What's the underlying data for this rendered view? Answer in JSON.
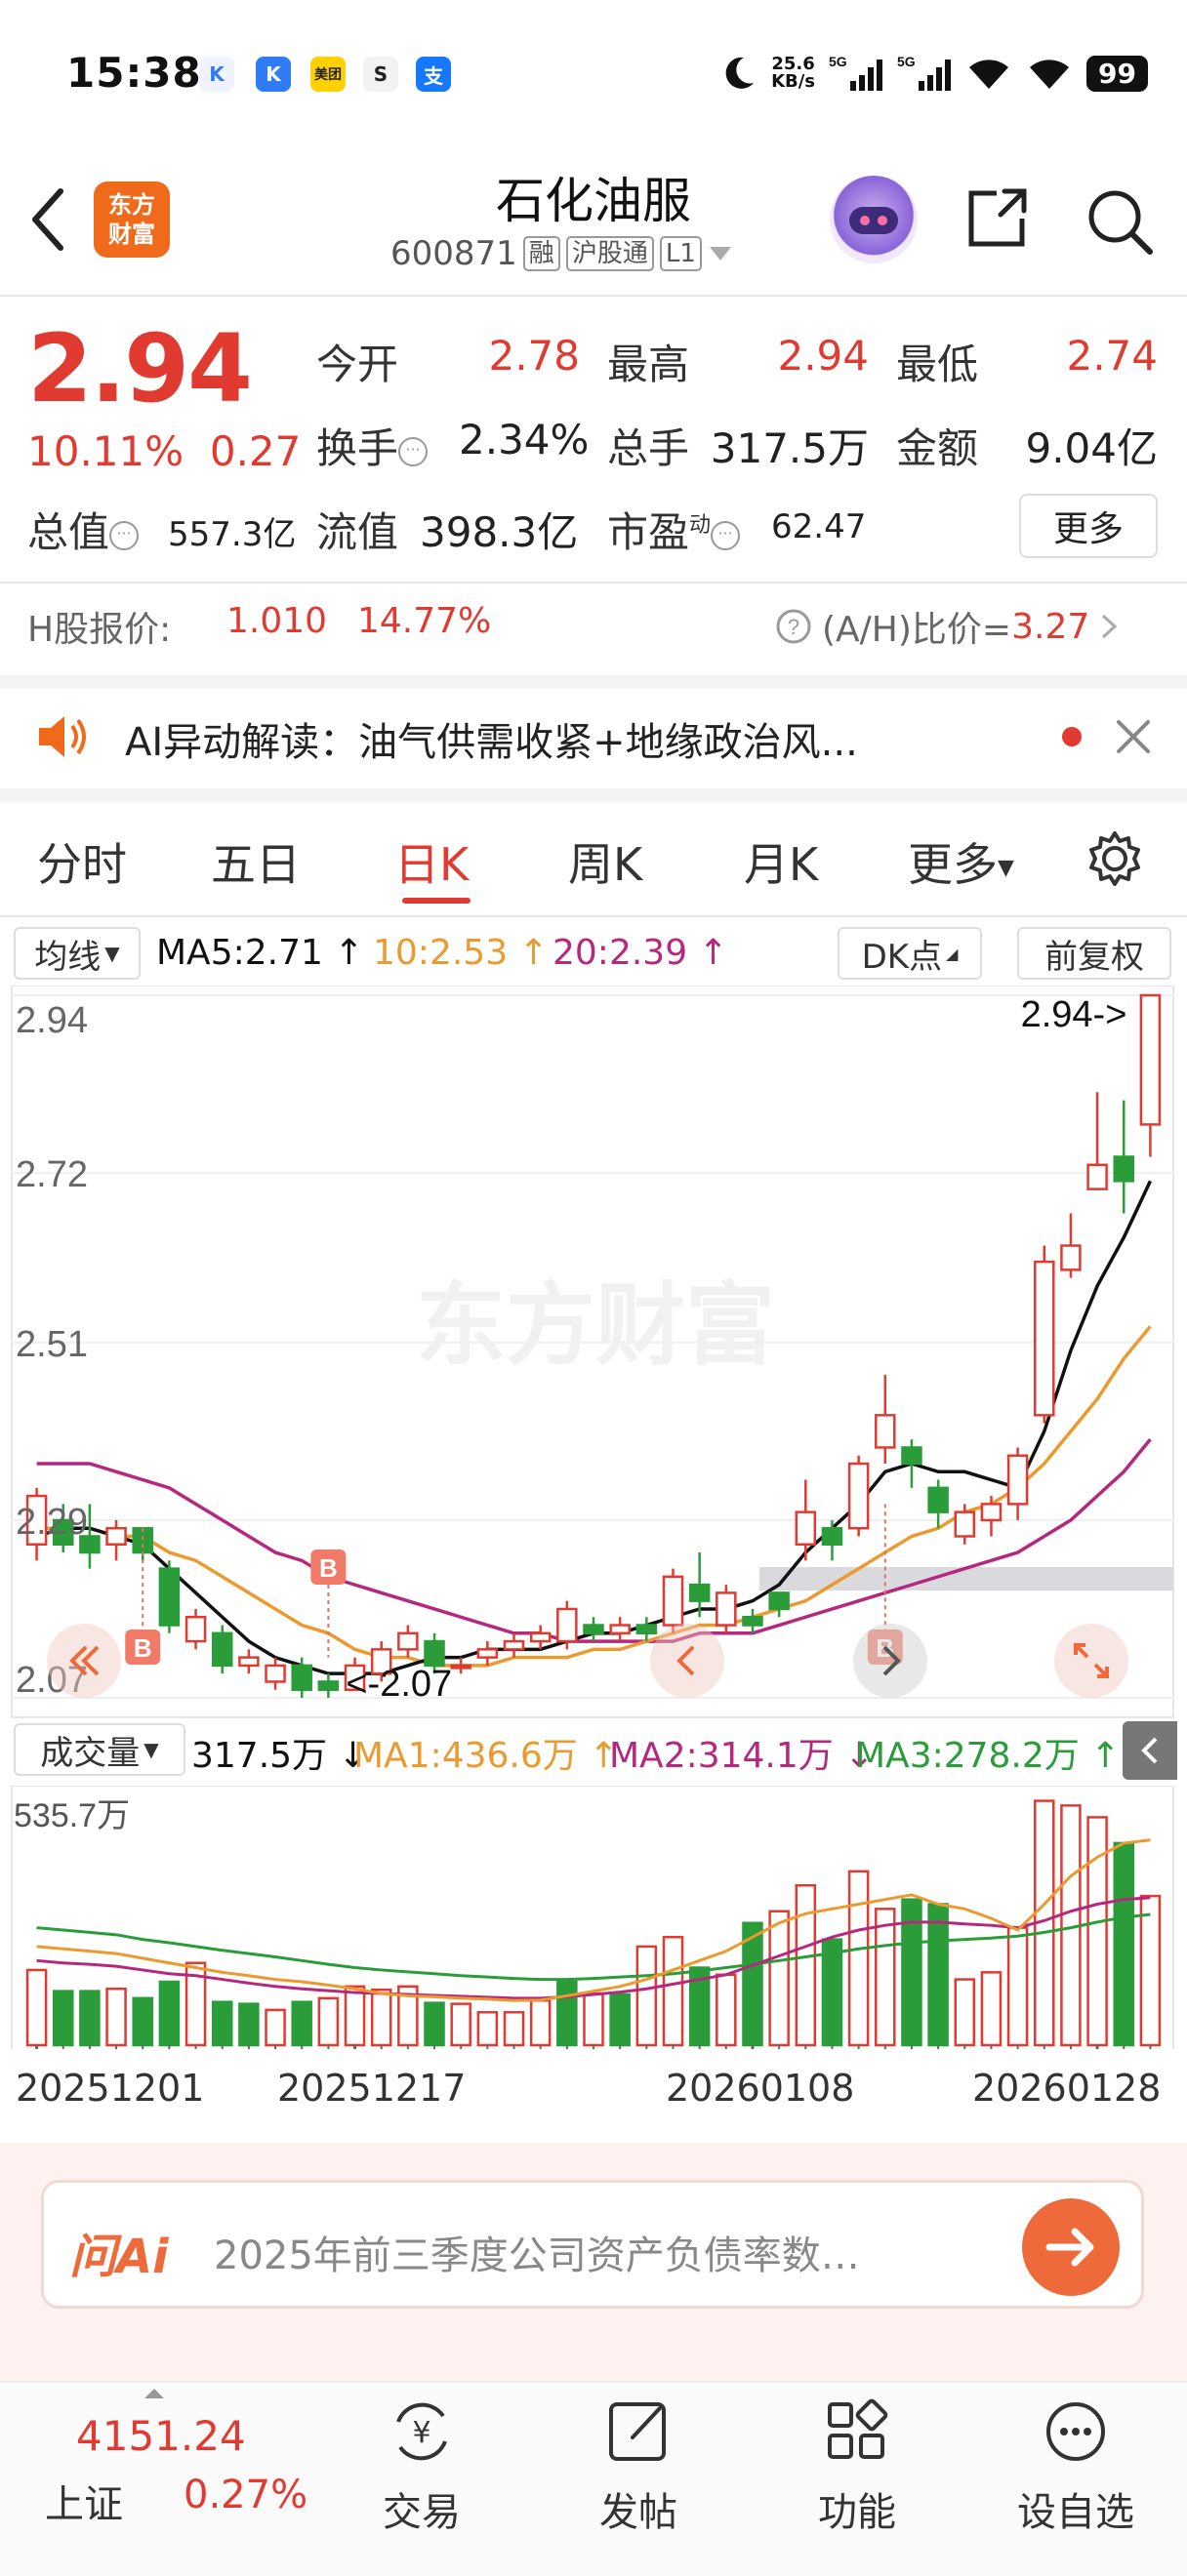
{
  "status_bar": {
    "time": "15:38",
    "net_speed_value": "25.6",
    "net_speed_unit": "KB/s",
    "signal1": "5G",
    "signal2": "5G",
    "battery": "99"
  },
  "header": {
    "logo_line1": "东方",
    "logo_line2": "财富",
    "title": "石化油服",
    "code": "600871",
    "tags": [
      "融",
      "沪股通",
      "L1"
    ]
  },
  "quote": {
    "price": "2.94",
    "change_pct": "10.11%",
    "change_amt": "0.27",
    "open_label": "今开",
    "open": "2.78",
    "high_label": "最高",
    "high": "2.94",
    "low_label": "最低",
    "low": "2.74",
    "turnover_label": "换手",
    "turnover": "2.34%",
    "volume_label": "总手",
    "volume": "317.5万",
    "amount_label": "金额",
    "amount": "9.04亿",
    "mktcap_label": "总值",
    "mktcap": "557.3亿",
    "float_label": "流值",
    "float_cap": "398.3亿",
    "pe_label": "市盈",
    "pe_sup": "动",
    "pe": "62.47",
    "more": "更多"
  },
  "hshare": {
    "label": "H股报价:",
    "price": "1.010",
    "pct": "14.77%",
    "ratio_label": "(A/H)比价=",
    "ratio": "3.27"
  },
  "ai_bar": {
    "text": "AI异动解读：油气供需收紧+地缘政治风..."
  },
  "tabs": [
    "分时",
    "五日",
    "日K",
    "周K",
    "月K",
    "更多"
  ],
  "active_tab": 2,
  "ma_bar": {
    "selector": "均线",
    "ma5": "MA5:2.71 ↑",
    "ma10": "10:2.53 ↑",
    "ma20": "20:2.39 ↑",
    "dk": "DK点",
    "fq": "前复权"
  },
  "price_axis": {
    "labels": [
      "2.94",
      "2.72",
      "2.51",
      "2.29",
      "2.07"
    ],
    "high_marker": "2.94->",
    "low_marker": "<-2.07",
    "b_marker": "B"
  },
  "volume_bar": {
    "selector": "成交量",
    "vol": "317.5万 ↓",
    "ma1": "MA1:436.6万 ↑",
    "ma2": "MA2:314.1万 ↓",
    "ma3": "MA3:278.2万 ↑",
    "max_label": "535.7万"
  },
  "dates": [
    "20251201",
    "20251217",
    "20260108",
    "20260128"
  ],
  "watermark": "东方财富",
  "colors": {
    "up": "#e03a31",
    "down": "#2a9d3a",
    "ma5": "#111111",
    "ma10": "#eb9a2f",
    "ma20": "#b5287e",
    "accent": "#ee6a3a"
  },
  "chart_data": {
    "type": "candlestick",
    "ylim": [
      2.07,
      2.94
    ],
    "candles": [
      {
        "o": 2.26,
        "c": 2.32,
        "h": 2.33,
        "l": 2.24
      },
      {
        "o": 2.29,
        "c": 2.26,
        "h": 2.31,
        "l": 2.25
      },
      {
        "o": 2.27,
        "c": 2.25,
        "h": 2.31,
        "l": 2.23
      },
      {
        "o": 2.26,
        "c": 2.28,
        "h": 2.29,
        "l": 2.24
      },
      {
        "o": 2.28,
        "c": 2.25,
        "h": 2.28,
        "l": 2.24
      },
      {
        "o": 2.23,
        "c": 2.16,
        "h": 2.24,
        "l": 2.15
      },
      {
        "o": 2.14,
        "c": 2.17,
        "h": 2.18,
        "l": 2.13
      },
      {
        "o": 2.15,
        "c": 2.11,
        "h": 2.16,
        "l": 2.1
      },
      {
        "o": 2.11,
        "c": 2.12,
        "h": 2.13,
        "l": 2.1
      },
      {
        "o": 2.09,
        "c": 2.11,
        "h": 2.12,
        "l": 2.08
      },
      {
        "o": 2.11,
        "c": 2.08,
        "h": 2.12,
        "l": 2.07
      },
      {
        "o": 2.09,
        "c": 2.08,
        "h": 2.1,
        "l": 2.07
      },
      {
        "o": 2.08,
        "c": 2.11,
        "h": 2.12,
        "l": 2.08
      },
      {
        "o": 2.1,
        "c": 2.13,
        "h": 2.14,
        "l": 2.09
      },
      {
        "o": 2.13,
        "c": 2.15,
        "h": 2.16,
        "l": 2.12
      },
      {
        "o": 2.14,
        "c": 2.11,
        "h": 2.15,
        "l": 2.1
      },
      {
        "o": 2.11,
        "c": 2.11,
        "h": 2.12,
        "l": 2.1
      },
      {
        "o": 2.12,
        "c": 2.13,
        "h": 2.14,
        "l": 2.11
      },
      {
        "o": 2.13,
        "c": 2.14,
        "h": 2.15,
        "l": 2.12
      },
      {
        "o": 2.14,
        "c": 2.15,
        "h": 2.16,
        "l": 2.13
      },
      {
        "o": 2.14,
        "c": 2.18,
        "h": 2.19,
        "l": 2.13
      },
      {
        "o": 2.16,
        "c": 2.15,
        "h": 2.17,
        "l": 2.14
      },
      {
        "o": 2.15,
        "c": 2.16,
        "h": 2.17,
        "l": 2.14
      },
      {
        "o": 2.16,
        "c": 2.15,
        "h": 2.17,
        "l": 2.14
      },
      {
        "o": 2.16,
        "c": 2.22,
        "h": 2.23,
        "l": 2.15
      },
      {
        "o": 2.21,
        "c": 2.19,
        "h": 2.25,
        "l": 2.17
      },
      {
        "o": 2.16,
        "c": 2.2,
        "h": 2.21,
        "l": 2.15
      },
      {
        "o": 2.17,
        "c": 2.16,
        "h": 2.18,
        "l": 2.15
      },
      {
        "o": 2.2,
        "c": 2.18,
        "h": 2.2,
        "l": 2.17
      },
      {
        "o": 2.26,
        "c": 2.3,
        "h": 2.34,
        "l": 2.24
      },
      {
        "o": 2.28,
        "c": 2.26,
        "h": 2.29,
        "l": 2.24
      },
      {
        "o": 2.28,
        "c": 2.36,
        "h": 2.37,
        "l": 2.27
      },
      {
        "o": 2.38,
        "c": 2.42,
        "h": 2.47,
        "l": 2.36
      },
      {
        "o": 2.38,
        "c": 2.36,
        "h": 2.39,
        "l": 2.33
      },
      {
        "o": 2.33,
        "c": 2.3,
        "h": 2.34,
        "l": 2.28
      },
      {
        "o": 2.27,
        "c": 2.3,
        "h": 2.31,
        "l": 2.26
      },
      {
        "o": 2.29,
        "c": 2.31,
        "h": 2.32,
        "l": 2.27
      },
      {
        "o": 2.31,
        "c": 2.37,
        "h": 2.38,
        "l": 2.29
      },
      {
        "o": 2.42,
        "c": 2.61,
        "h": 2.63,
        "l": 2.41
      },
      {
        "o": 2.6,
        "c": 2.63,
        "h": 2.67,
        "l": 2.59
      },
      {
        "o": 2.7,
        "c": 2.73,
        "h": 2.82,
        "l": 2.7
      },
      {
        "o": 2.74,
        "c": 2.71,
        "h": 2.81,
        "l": 2.67
      },
      {
        "o": 2.78,
        "c": 2.94,
        "h": 2.94,
        "l": 2.74
      }
    ],
    "volume_ylim": [
      0,
      535.7
    ],
    "volume": [
      160,
      115,
      115,
      120,
      100,
      135,
      175,
      92,
      88,
      75,
      92,
      100,
      125,
      118,
      125,
      90,
      88,
      70,
      70,
      95,
      135,
      110,
      108,
      210,
      230,
      165,
      150,
      260,
      285,
      340,
      225,
      370,
      290,
      310,
      300,
      140,
      155,
      250,
      520,
      510,
      485,
      430,
      317.5
    ],
    "vol_up": [
      true,
      false,
      false,
      true,
      false,
      false,
      true,
      false,
      false,
      true,
      false,
      true,
      true,
      true,
      true,
      false,
      true,
      true,
      true,
      true,
      false,
      true,
      false,
      true,
      true,
      false,
      true,
      false,
      true,
      true,
      false,
      true,
      true,
      false,
      false,
      true,
      true,
      true,
      true,
      true,
      true,
      false,
      true
    ],
    "ma5": [
      2.27,
      2.28,
      2.28,
      2.27,
      2.26,
      2.23,
      2.2,
      2.17,
      2.14,
      2.12,
      2.11,
      2.1,
      2.1,
      2.1,
      2.11,
      2.12,
      2.12,
      2.13,
      2.13,
      2.13,
      2.14,
      2.15,
      2.15,
      2.16,
      2.17,
      2.18,
      2.18,
      2.19,
      2.21,
      2.25,
      2.28,
      2.31,
      2.35,
      2.36,
      2.35,
      2.35,
      2.34,
      2.33,
      2.4,
      2.5,
      2.58,
      2.64,
      2.71
    ],
    "ma10": [
      2.28,
      2.28,
      2.28,
      2.27,
      2.27,
      2.25,
      2.24,
      2.22,
      2.2,
      2.18,
      2.16,
      2.15,
      2.13,
      2.12,
      2.12,
      2.11,
      2.11,
      2.11,
      2.12,
      2.12,
      2.12,
      2.13,
      2.13,
      2.14,
      2.15,
      2.16,
      2.16,
      2.17,
      2.18,
      2.19,
      2.21,
      2.23,
      2.25,
      2.27,
      2.28,
      2.3,
      2.31,
      2.33,
      2.36,
      2.4,
      2.44,
      2.49,
      2.53
    ],
    "ma20": [
      2.36,
      2.36,
      2.36,
      2.35,
      2.34,
      2.33,
      2.31,
      2.29,
      2.27,
      2.25,
      2.24,
      2.22,
      2.21,
      2.2,
      2.19,
      2.18,
      2.17,
      2.16,
      2.15,
      2.15,
      2.14,
      2.14,
      2.14,
      2.14,
      2.14,
      2.15,
      2.15,
      2.15,
      2.16,
      2.17,
      2.18,
      2.19,
      2.2,
      2.21,
      2.22,
      2.23,
      2.24,
      2.25,
      2.27,
      2.29,
      2.32,
      2.35,
      2.39
    ],
    "vol_ma1": [
      210,
      205,
      200,
      195,
      185,
      175,
      165,
      155,
      148,
      140,
      135,
      128,
      120,
      110,
      105,
      103,
      100,
      98,
      95,
      96,
      105,
      115,
      125,
      140,
      160,
      180,
      200,
      230,
      260,
      280,
      290,
      300,
      310,
      320,
      300,
      290,
      270,
      245,
      300,
      360,
      400,
      430,
      436.6
    ],
    "vol_ma2": [
      180,
      175,
      172,
      168,
      160,
      152,
      148,
      140,
      132,
      125,
      120,
      116,
      112,
      110,
      108,
      106,
      104,
      102,
      100,
      100,
      103,
      108,
      113,
      120,
      130,
      140,
      150,
      170,
      190,
      210,
      230,
      245,
      255,
      262,
      262,
      258,
      255,
      250,
      265,
      285,
      300,
      310,
      314.1
    ],
    "vol_ma3": [
      250,
      245,
      240,
      235,
      225,
      218,
      210,
      202,
      195,
      188,
      180,
      172,
      165,
      160,
      156,
      152,
      148,
      145,
      142,
      140,
      140,
      142,
      145,
      148,
      152,
      158,
      165,
      172,
      180,
      188,
      196,
      205,
      212,
      218,
      222,
      225,
      228,
      232,
      240,
      250,
      262,
      272,
      278.2
    ]
  }
}
